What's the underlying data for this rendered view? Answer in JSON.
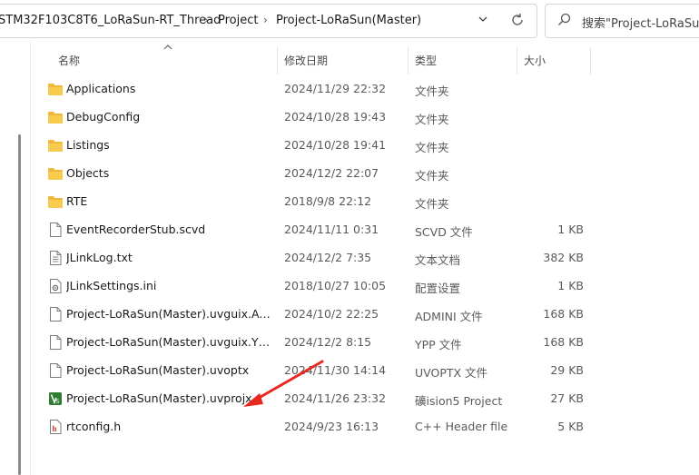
{
  "address": {
    "crumbs": [
      "STM32F103C8T6_LoRaSun-RT_Thread",
      "Project",
      "Project-LoRaSun(Master)"
    ],
    "separator": "›"
  },
  "search": {
    "placeholder": "搜索\"Project-LoRaSun("
  },
  "columns": {
    "name": "名称",
    "date": "修改日期",
    "type": "类型",
    "size": "大小"
  },
  "files": [
    {
      "name": "Applications",
      "date": "2024/11/29 22:32",
      "type": "文件夹",
      "size": "",
      "icon": "folder-icon"
    },
    {
      "name": "DebugConfig",
      "date": "2024/10/28 19:43",
      "type": "文件夹",
      "size": "",
      "icon": "folder-icon"
    },
    {
      "name": "Listings",
      "date": "2024/10/28 19:41",
      "type": "文件夹",
      "size": "",
      "icon": "folder-icon"
    },
    {
      "name": "Objects",
      "date": "2024/12/2 22:07",
      "type": "文件夹",
      "size": "",
      "icon": "folder-icon"
    },
    {
      "name": "RTE",
      "date": "2018/9/8 22:12",
      "type": "文件夹",
      "size": "",
      "icon": "folder-icon"
    },
    {
      "name": "EventRecorderStub.scvd",
      "date": "2024/11/11 0:31",
      "type": "SCVD 文件",
      "size": "1 KB",
      "icon": "file-icon"
    },
    {
      "name": "JLinkLog.txt",
      "date": "2024/12/2 7:35",
      "type": "文本文档",
      "size": "382 KB",
      "icon": "text-file-icon"
    },
    {
      "name": "JLinkSettings.ini",
      "date": "2018/10/27 10:05",
      "type": "配置设置",
      "size": "1 KB",
      "icon": "settings-file-icon"
    },
    {
      "name": "Project-LoRaSun(Master).uvguix.Admi...",
      "date": "2024/10/2 22:25",
      "type": "ADMINI 文件",
      "size": "168 KB",
      "icon": "file-icon"
    },
    {
      "name": "Project-LoRaSun(Master).uvguix.YPP",
      "date": "2024/12/2 8:15",
      "type": "YPP 文件",
      "size": "168 KB",
      "icon": "file-icon"
    },
    {
      "name": "Project-LoRaSun(Master).uvoptx",
      "date": "2024/11/30 14:14",
      "type": "UVOPTX 文件",
      "size": "29 KB",
      "icon": "file-icon"
    },
    {
      "name": "Project-LoRaSun(Master).uvprojx",
      "date": "2024/11/26 23:32",
      "type": "礦ision5 Project",
      "size": "27 KB",
      "icon": "keil-project-icon"
    },
    {
      "name": "rtconfig.h",
      "date": "2024/9/23 16:13",
      "type": "C++ Header file",
      "size": "5 KB",
      "icon": "header-file-icon"
    }
  ],
  "colors": {
    "folder": "#f5c242",
    "arrow": "#e8281e",
    "keil": "#2e7d32"
  }
}
